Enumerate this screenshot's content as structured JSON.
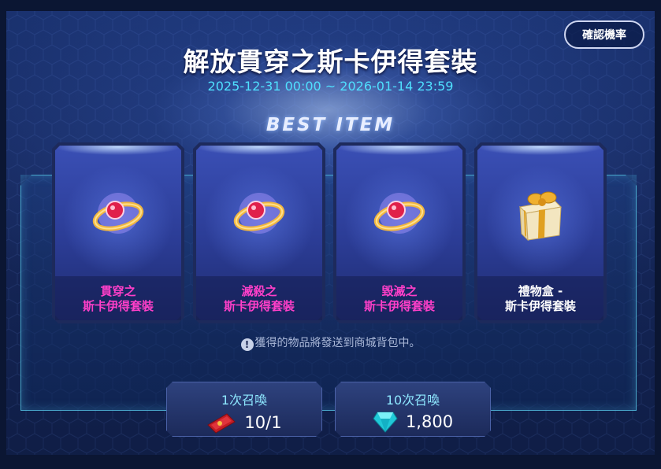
{
  "header": {
    "title": "解放貫穿之斯卡伊得套裝",
    "period": "2025-12-31 00:00 ~ 2026-01-14 23:59",
    "probability_button": "確認機率",
    "best_item_label": "BEST ITEM"
  },
  "items": [
    {
      "line1": "貫穿之",
      "line2": "斯卡伊得套裝",
      "icon": "ruby-ring-icon",
      "color": "#ff3fc9"
    },
    {
      "line1": "滅殺之",
      "line2": "斯卡伊得套裝",
      "icon": "ruby-ring-icon",
      "color": "#ff3fc9"
    },
    {
      "line1": "毀滅之",
      "line2": "斯卡伊得套裝",
      "icon": "ruby-ring-icon",
      "color": "#ff3fc9"
    },
    {
      "line1": "禮物盒 -",
      "line2": "斯卡伊得套裝",
      "icon": "gift-box-icon",
      "color": "#ffffff"
    }
  ],
  "notice": "獲得的物品將發送到商城背包中。",
  "summon": {
    "single": {
      "label": "1次召喚",
      "cost": "10/1",
      "icon": "red-ticket-icon"
    },
    "ten": {
      "label": "10次召喚",
      "cost": "1,800",
      "icon": "diamond-icon"
    }
  },
  "colors": {
    "accent_cyan": "#4fe0ff",
    "item_name_pink": "#ff3fc9",
    "summon_label": "#8ee8ff"
  }
}
